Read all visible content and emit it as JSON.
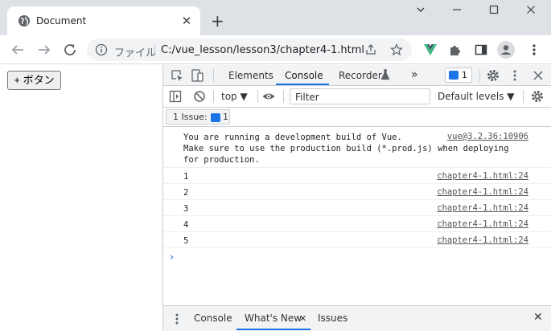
{
  "browser": {
    "tab_title": "Document",
    "tab_close": "✕",
    "new_tab": "+",
    "omnibox": {
      "label": "ファイル",
      "url": "C:/vue_lesson/lesson3/chapter4-1.html"
    }
  },
  "page": {
    "button_label": "+ ボタン"
  },
  "devtools": {
    "tabs": [
      "Elements",
      "Console",
      "Recorder"
    ],
    "more_tabs": "»",
    "active_tab": "Console",
    "issue_count": "1",
    "context": "top ▼",
    "filter_placeholder": "Filter",
    "levels": "Default levels ▼",
    "issues_label": "1 Issue:",
    "issues_count": "1",
    "messages": [
      {
        "line1": "You are running a development build of Vue.",
        "line2": "Make sure to use the production build (*.prod.js) when deploying",
        "line3": "for production.",
        "source": "vue@3.2.36:10906"
      },
      {
        "text": "1",
        "source": "chapter4-1.html:24"
      },
      {
        "text": "2",
        "source": "chapter4-1.html:24"
      },
      {
        "text": "3",
        "source": "chapter4-1.html:24"
      },
      {
        "text": "4",
        "source": "chapter4-1.html:24"
      },
      {
        "text": "5",
        "source": "chapter4-1.html:24"
      }
    ],
    "prompt": "›",
    "drawer": {
      "tabs": [
        "Console",
        "What's New",
        "Issues"
      ],
      "close": "✕"
    }
  },
  "colors": {
    "accent": "#1a73e8",
    "tabstrip": "#dee1e6",
    "vue_green": "#41b883"
  },
  "icons": [
    "globe-icon",
    "minimize-icon",
    "maximize-icon",
    "close-icon",
    "back-icon",
    "forward-icon",
    "reload-icon",
    "info-icon",
    "share-icon",
    "star-icon",
    "vue-devtools-icon",
    "puzzle-icon",
    "sidebar-icon",
    "profile-icon",
    "kebab-icon",
    "inspect-icon",
    "device-icon",
    "gear-icon",
    "sidebar-toggle-icon",
    "clear-icon",
    "eye-icon"
  ]
}
